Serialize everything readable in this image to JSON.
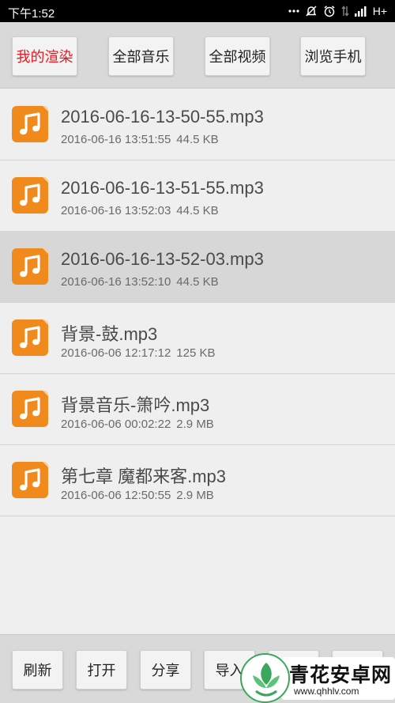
{
  "status_bar": {
    "time": "下午1:52",
    "network": "H+",
    "icons": [
      "more-dots-icon",
      "mute-icon",
      "alarm-icon",
      "data-arrows-icon",
      "signal-icon"
    ]
  },
  "top_tabs": [
    {
      "label": "我的渲染",
      "active": true
    },
    {
      "label": "全部音乐",
      "active": false
    },
    {
      "label": "全部视频",
      "active": false
    },
    {
      "label": "浏览手机",
      "active": false
    }
  ],
  "files": [
    {
      "name": "2016-06-16-13-50-55.mp3",
      "date": "2016-06-16 13:51:55",
      "size": "44.5 KB",
      "selected": false,
      "icon": "music-file-icon"
    },
    {
      "name": "2016-06-16-13-51-55.mp3",
      "date": "2016-06-16 13:52:03",
      "size": "44.5 KB",
      "selected": false,
      "icon": "music-file-icon"
    },
    {
      "name": "2016-06-16-13-52-03.mp3",
      "date": "2016-06-16 13:52:10",
      "size": "44.5 KB",
      "selected": true,
      "icon": "music-file-icon"
    },
    {
      "name": "背景-鼓.mp3",
      "date": "2016-06-06 12:17:12",
      "size": "125 KB",
      "selected": false,
      "icon": "music-file-icon"
    },
    {
      "name": "背景音乐-箫吟.mp3",
      "date": "2016-06-06 00:02:22",
      "size": "2.9 MB",
      "selected": false,
      "icon": "music-file-icon"
    },
    {
      "name": "第七章 魔都来客.mp3",
      "date": "2016-06-06 12:50:55",
      "size": "2.9 MB",
      "selected": false,
      "icon": "music-file-icon"
    }
  ],
  "bottom_actions": [
    {
      "label": "刷新"
    },
    {
      "label": "打开"
    },
    {
      "label": "分享"
    },
    {
      "label": "导入"
    },
    {
      "label": ""
    },
    {
      "label": ""
    }
  ],
  "watermark": {
    "title": "青花安卓网",
    "url": "www.qhhlv.com"
  },
  "colors": {
    "active_tab": "#e8191e",
    "icon_orange": "#f08a1c",
    "selected_row": "#d7d7d7",
    "watermark_green": "#3aa85c"
  }
}
